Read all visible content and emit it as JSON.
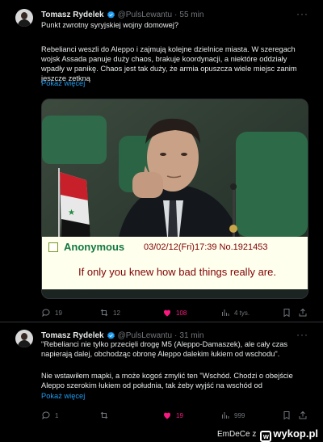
{
  "tweets": [
    {
      "author": "Tomasz Rydelek",
      "handle": "@PulsLewantu",
      "separator": "·",
      "time": "55 min",
      "question": "Punkt zwrotny syryjskiej wojny domowej?",
      "paragraph": "Rebelianci weszli do Aleppo i zajmują kolejne dzielnice miasta. W szeregach wojsk Assada panuje duży chaos, brakuje koordynacji, a niektóre oddziały wpadły w panikę. Chaos jest tak duży, że armia opuszcza wiele miejsc zanim jeszcze zetkną",
      "show_more": "Pokaż więcej",
      "media": {
        "greentext_name": "Anonymous",
        "greentext_date": "03/02/12(Fri)17:39 No.1921453",
        "greentext_message": "If only you knew how bad things really are."
      },
      "actions": {
        "replies": "19",
        "reposts": "12",
        "likes": "108",
        "views": "4 tys."
      }
    },
    {
      "author": "Tomasz Rydelek",
      "handle": "@PulsLewantu",
      "separator": "·",
      "time": "31 min",
      "paragraph1": "\"Rebelianci nie tylko przecięli drogę M5 (Aleppo-Damaszek), ale cały czas napierają dalej, obchodząc obronę Aleppo dalekim łukiem od wschodu\".",
      "paragraph2": "Nie wstawiłem mapki, a może kogoś zmylić ten \"Wschód. Chodzi o obejście Aleppo szerokim łukiem od południa, tak żeby wyjść na wschód od",
      "show_more": "Pokaż więcej",
      "actions": {
        "replies": "1",
        "reposts": "",
        "likes": "19",
        "views": "999"
      }
    }
  ],
  "watermark": {
    "user": "EmDeCe z",
    "site": "wykop.pl"
  },
  "colors": {
    "accent": "#1d9bf0",
    "like": "#f91880",
    "muted": "#71767b",
    "greentext_name": "#117743",
    "greentext_text": "#800000"
  },
  "icons": [
    "verified-badge-icon",
    "more-icon",
    "reply-icon",
    "repost-icon",
    "like-icon",
    "views-icon",
    "bookmark-icon",
    "share-icon"
  ]
}
